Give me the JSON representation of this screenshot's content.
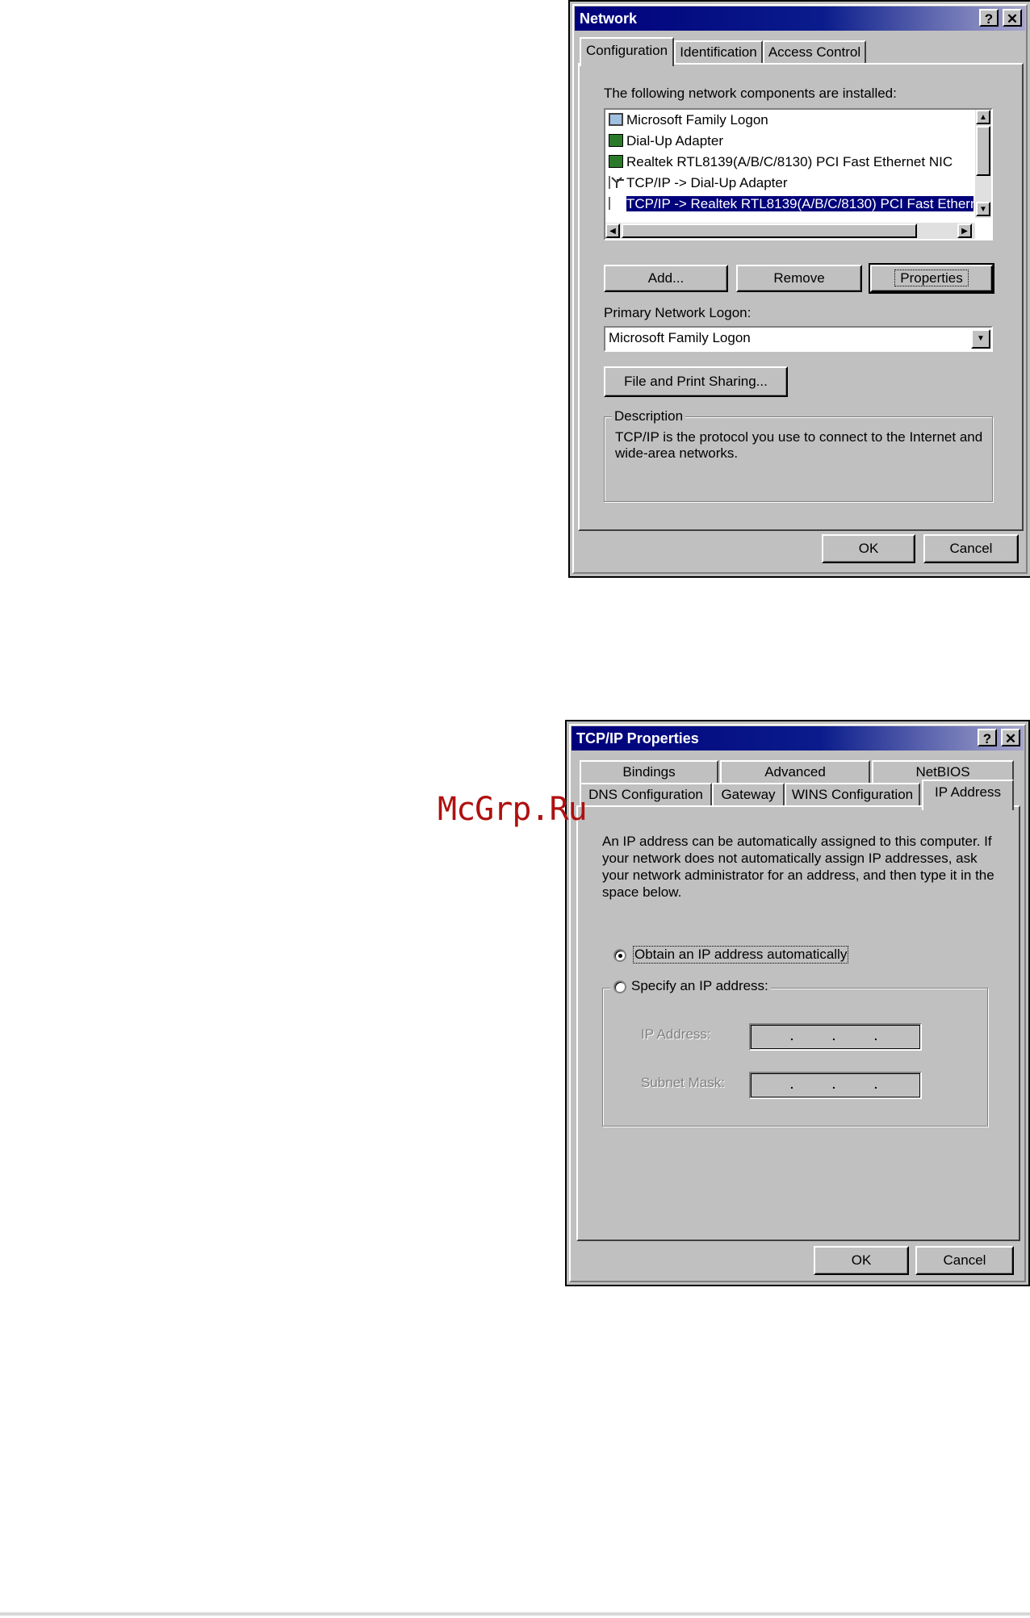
{
  "network_dialog": {
    "title": "Network",
    "help_btn": "?",
    "close_btn": "✕",
    "tabs": [
      "Configuration",
      "Identification",
      "Access Control"
    ],
    "installed_label": "The following network components are installed:",
    "components": [
      {
        "label": "Microsoft Family Logon",
        "icon": "computer-icon"
      },
      {
        "label": "Dial-Up Adapter",
        "icon": "network-card-icon"
      },
      {
        "label": "Realtek RTL8139(A/B/C/8130) PCI Fast Ethernet NIC",
        "icon": "network-card-icon"
      },
      {
        "label": "TCP/IP -> Dial-Up Adapter",
        "icon": "protocol-icon"
      },
      {
        "label": "TCP/IP -> Realtek RTL8139(A/B/C/8130) PCI Fast Ethern",
        "icon": "protocol-icon",
        "selected": true
      }
    ],
    "add_button": "Add...",
    "remove_button": "Remove",
    "properties_button": "Properties",
    "primary_logon_label": "Primary Network Logon:",
    "primary_logon_value": "Microsoft Family Logon",
    "file_print_button": "File and Print Sharing...",
    "description_legend": "Description",
    "description_text": "TCP/IP is the protocol you use to connect to the Internet and wide-area networks.",
    "ok_button": "OK",
    "cancel_button": "Cancel"
  },
  "tcpip_dialog": {
    "title": "TCP/IP Properties",
    "help_btn": "?",
    "close_btn": "✕",
    "tabs_row1": [
      "Bindings",
      "Advanced",
      "NetBIOS"
    ],
    "tabs_row2": [
      "DNS Configuration",
      "Gateway",
      "WINS Configuration",
      "IP Address"
    ],
    "intro_text": "An IP address can be automatically assigned to this computer. If your network does not automatically assign IP addresses, ask your network administrator for an address, and then type it in the space below.",
    "obtain_auto_label": "Obtain an IP address automatically",
    "specify_label": "Specify an IP address:",
    "selected_option": "obtain",
    "ip_address_label": "IP Address:",
    "subnet_mask_label": "Subnet Mask:",
    "ok_button": "OK",
    "cancel_button": "Cancel"
  },
  "watermark": "McGrp.Ru",
  "colors": {
    "dialog_bg": "#c0c0c0",
    "title_bar": "#00007b",
    "selection": "#00007b",
    "watermark": "#b01010"
  }
}
